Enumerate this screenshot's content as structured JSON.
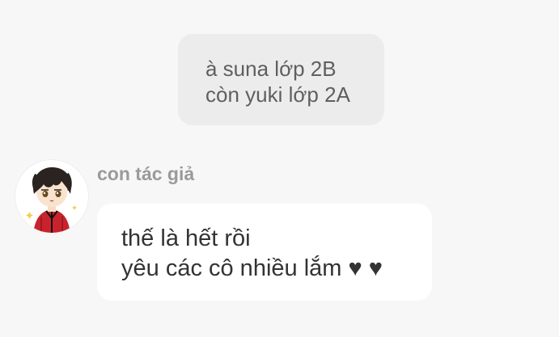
{
  "system_bubble": {
    "lines": [
      "à suna lớp 2B",
      "còn yuki lớp 2A"
    ]
  },
  "message": {
    "sender": "con tác giả",
    "lines": [
      "thế là hết rồi",
      "yêu các cô nhiều lắm ♥ ♥"
    ],
    "avatar_icon": "chibi-character-avatar"
  },
  "colors": {
    "background": "#f7f7f7",
    "system_bubble": "#ececec",
    "message_bubble": "#ffffff",
    "sender_name": "#9a9a9a",
    "text": "#333333"
  }
}
